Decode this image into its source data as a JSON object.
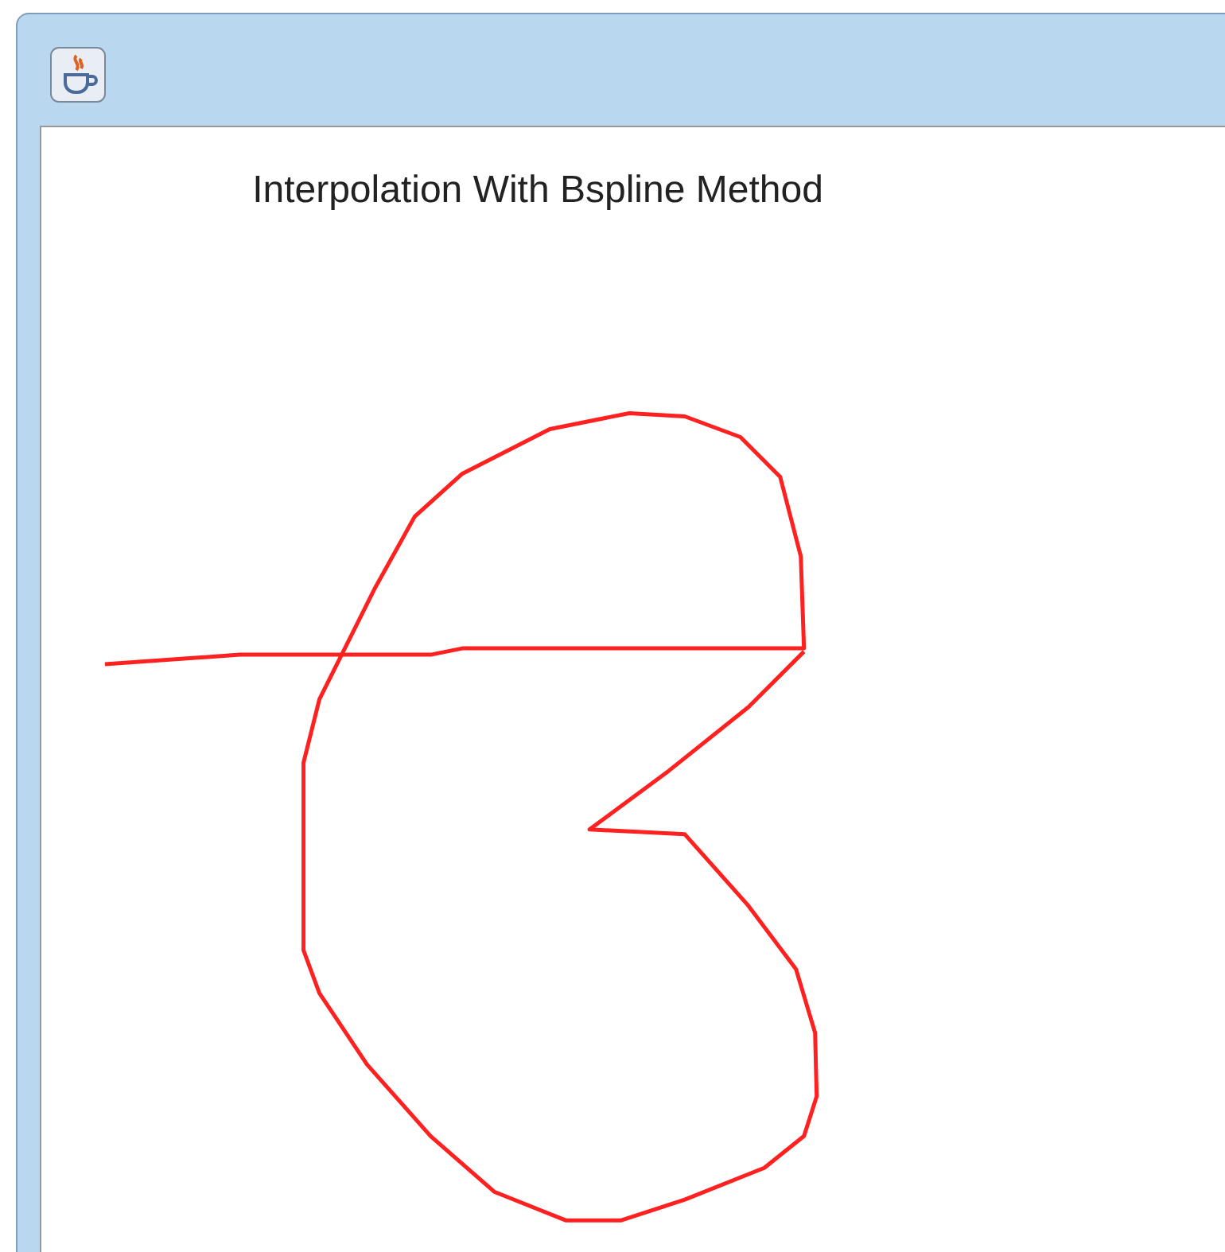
{
  "plot": {
    "title": "Interpolation With Bspline Method"
  }
}
